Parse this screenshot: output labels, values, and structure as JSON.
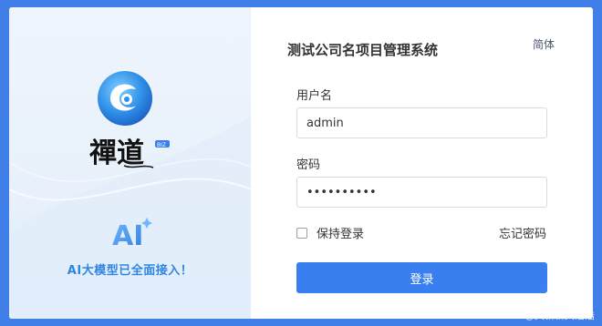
{
  "brand": {
    "logo_text": "禪道",
    "ai_caption": "AI大模型已全面接入！",
    "ai_badge_text": "AI",
    "logo_small_tag": "BIZ"
  },
  "header": {
    "system_title": "测试公司名项目管理系统",
    "language_label": "简体"
  },
  "form": {
    "username_label": "用户名",
    "username_value": "admin",
    "password_label": "密码",
    "password_value": "••••••••••",
    "remember_label": "保持登录",
    "forgot_label": "忘记密码",
    "login_label": "登录"
  },
  "watermark": "CSDN @大新新大浩浩",
  "colors": {
    "background": "#3f7fe7",
    "primary_button": "#3a7ff0",
    "ai_caption": "#2f86e0"
  }
}
